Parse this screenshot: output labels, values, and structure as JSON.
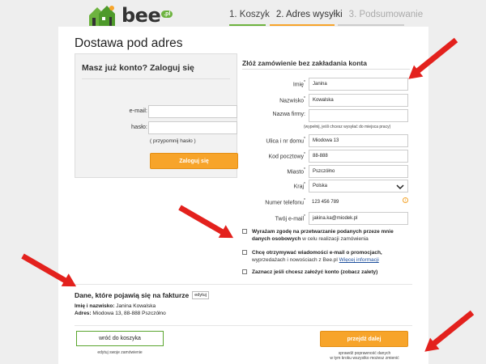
{
  "header": {
    "logo_text": "bee",
    "logo_badge": ".pl",
    "steps": [
      {
        "label": "1. Koszyk",
        "state": "done"
      },
      {
        "label": "2. Adres wysyłki",
        "state": "active"
      },
      {
        "label": "3. Podsumowanie",
        "state": "todo"
      }
    ]
  },
  "page": {
    "title": "Dostawa pod adres"
  },
  "login": {
    "heading": "Masz już konto? Zaloguj się",
    "email_label": "e-mail:",
    "password_label": "hasło:",
    "email_value": "",
    "password_value": "",
    "remind_link": "( przypomnij hasło )",
    "submit_label": "Zaloguj się"
  },
  "guest": {
    "heading": "Złóż zamówienie bez zakładania konta",
    "fields": {
      "first_name": {
        "label": "Imię",
        "value": "Janina"
      },
      "last_name": {
        "label": "Nazwisko",
        "value": "Kowalska"
      },
      "company": {
        "label": "Nazwa firmy:",
        "value": "",
        "hint": "(wypełnij, jeśli chcesz wysyłać do miejsca pracy)"
      },
      "street": {
        "label": "Ulica i nr domu",
        "value": "Miodowa 13"
      },
      "postcode": {
        "label": "Kod pocztowy",
        "value": "88-888"
      },
      "city": {
        "label": "Miasto",
        "value": "Pszczółno"
      },
      "country": {
        "label": "Kraj",
        "value": "Polska"
      },
      "phone": {
        "label": "Numer telefonu",
        "value": "123 456 789"
      },
      "email": {
        "label": "Twój e-mail",
        "value": "jakina.ka@miodek.pl"
      }
    },
    "info_icon": "i",
    "consents": {
      "processing_bold": "Wyrażam zgodę na przetwarzanie podanych przeze mnie danych osobowych",
      "processing_rest": " w celu realizacji zamówienia",
      "marketing_bold": "Chcę otrzymywać wiadomości e-mail o promocjach,",
      "marketing_rest": " wyprzedażach i nowościach z Bee.pl ",
      "marketing_link": "Więcej informacji",
      "account": "Zaznacz jeśli chcesz założyć konto (zobacz zalety)"
    }
  },
  "invoice": {
    "heading": "Dane, które pojawią się na fakturze",
    "edit_label": "edytuj",
    "name_label": "Imię i nazwisko:",
    "name_value": " Janina Kowalska",
    "address_label": "Adres:",
    "address_value": " Miodowa 13, 88-888 Pszczółno"
  },
  "footer": {
    "back_label": "wróć do koszyka",
    "back_caption": "edytuj swoje zamówienie",
    "next_label": "przejdź dalej",
    "next_caption_1": "sprawdź poprawność danych",
    "next_caption_2": "w tym kroku wszystko możesz zmienić"
  },
  "colors": {
    "accent": "#f7a42a",
    "green": "#5aa52e",
    "arrow": "#e3211d",
    "link": "#1d4e9c"
  }
}
